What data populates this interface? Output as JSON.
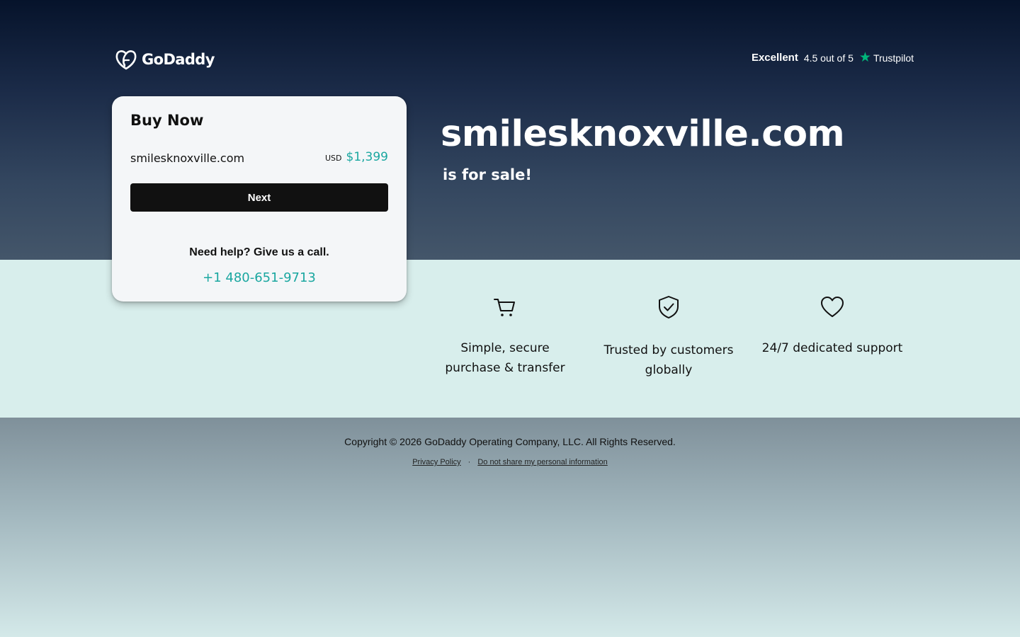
{
  "brand": {
    "logo_text": "GoDaddy"
  },
  "trustpilot": {
    "label": "Excellent",
    "rating_text": "4.5 out of 5",
    "brand": "Trustpilot",
    "star_color": "#00b67a"
  },
  "card": {
    "title": "Buy Now",
    "domain": "smilesknoxville.com",
    "currency": "USD",
    "price": "$1,399",
    "next_label": "Next",
    "help_text": "Need help? Give us a call.",
    "phone": "+1 480-651-9713"
  },
  "hero": {
    "domain": "smilesknoxville.com",
    "subtitle": "is for sale!"
  },
  "features": [
    {
      "icon": "cart-icon",
      "label": "Simple, secure purchase & transfer"
    },
    {
      "icon": "shield-check-icon",
      "label": "Trusted by customers globally"
    },
    {
      "icon": "heart-icon",
      "label": "24/7 dedicated support"
    }
  ],
  "footer": {
    "copyright": "Copyright © 2026 GoDaddy Operating Company, LLC. All Rights Reserved.",
    "privacy_link": "Privacy Policy",
    "separator": "·",
    "do_not_share_link": "Do not share my personal information"
  },
  "colors": {
    "accent": "#1aa7a0",
    "button": "#111111",
    "band": "#d8eeec"
  }
}
